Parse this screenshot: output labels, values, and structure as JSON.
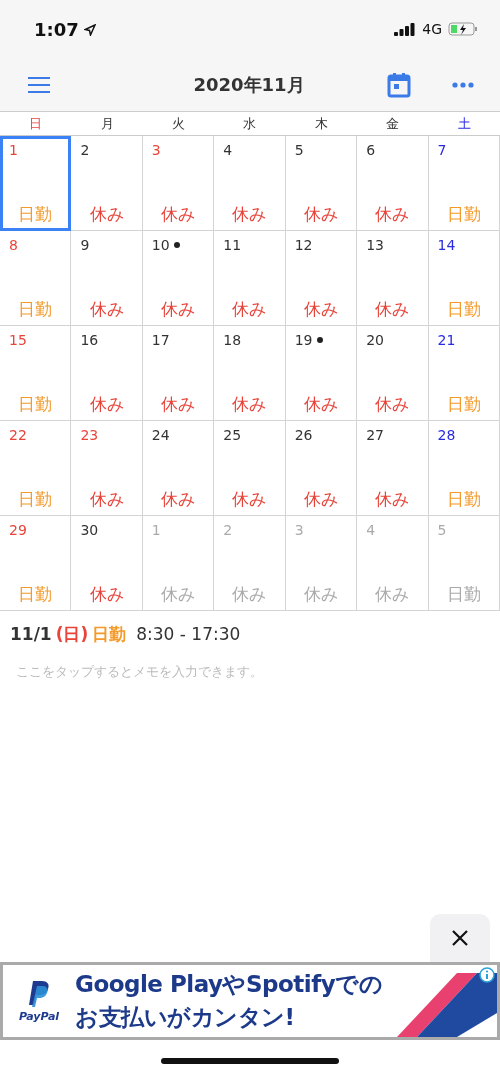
{
  "status_bar": {
    "time": "1:07",
    "network": "4G"
  },
  "header": {
    "title": "2020年11月"
  },
  "weekdays": [
    {
      "label": "日",
      "kind": "sunday"
    },
    {
      "label": "月",
      "kind": "weekday"
    },
    {
      "label": "火",
      "kind": "weekday"
    },
    {
      "label": "水",
      "kind": "weekday"
    },
    {
      "label": "木",
      "kind": "weekday"
    },
    {
      "label": "金",
      "kind": "weekday"
    },
    {
      "label": "土",
      "kind": "saturday"
    }
  ],
  "days": [
    {
      "number": "1",
      "kind": "sunday",
      "shift": {
        "label": "日勤",
        "kind": "work"
      },
      "dimmed": false,
      "dot": false,
      "selected": true
    },
    {
      "number": "2",
      "kind": "weekday",
      "shift": {
        "label": "休み",
        "kind": "off"
      },
      "dimmed": false,
      "dot": false,
      "selected": false
    },
    {
      "number": "3",
      "kind": "holiday",
      "shift": {
        "label": "休み",
        "kind": "off"
      },
      "dimmed": false,
      "dot": false,
      "selected": false
    },
    {
      "number": "4",
      "kind": "weekday",
      "shift": {
        "label": "休み",
        "kind": "off"
      },
      "dimmed": false,
      "dot": false,
      "selected": false
    },
    {
      "number": "5",
      "kind": "weekday",
      "shift": {
        "label": "休み",
        "kind": "off"
      },
      "dimmed": false,
      "dot": false,
      "selected": false
    },
    {
      "number": "6",
      "kind": "weekday",
      "shift": {
        "label": "休み",
        "kind": "off"
      },
      "dimmed": false,
      "dot": false,
      "selected": false
    },
    {
      "number": "7",
      "kind": "saturday",
      "shift": {
        "label": "日勤",
        "kind": "work"
      },
      "dimmed": false,
      "dot": false,
      "selected": false
    },
    {
      "number": "8",
      "kind": "sunday",
      "shift": {
        "label": "日勤",
        "kind": "work"
      },
      "dimmed": false,
      "dot": false,
      "selected": false
    },
    {
      "number": "9",
      "kind": "weekday",
      "shift": {
        "label": "休み",
        "kind": "off"
      },
      "dimmed": false,
      "dot": false,
      "selected": false
    },
    {
      "number": "10",
      "kind": "weekday",
      "shift": {
        "label": "休み",
        "kind": "off"
      },
      "dimmed": false,
      "dot": true,
      "selected": false
    },
    {
      "number": "11",
      "kind": "weekday",
      "shift": {
        "label": "休み",
        "kind": "off"
      },
      "dimmed": false,
      "dot": false,
      "selected": false
    },
    {
      "number": "12",
      "kind": "weekday",
      "shift": {
        "label": "休み",
        "kind": "off"
      },
      "dimmed": false,
      "dot": false,
      "selected": false
    },
    {
      "number": "13",
      "kind": "weekday",
      "shift": {
        "label": "休み",
        "kind": "off"
      },
      "dimmed": false,
      "dot": false,
      "selected": false
    },
    {
      "number": "14",
      "kind": "saturday",
      "shift": {
        "label": "日勤",
        "kind": "work"
      },
      "dimmed": false,
      "dot": false,
      "selected": false
    },
    {
      "number": "15",
      "kind": "sunday",
      "shift": {
        "label": "日勤",
        "kind": "work"
      },
      "dimmed": false,
      "dot": false,
      "selected": false
    },
    {
      "number": "16",
      "kind": "weekday",
      "shift": {
        "label": "休み",
        "kind": "off"
      },
      "dimmed": false,
      "dot": false,
      "selected": false
    },
    {
      "number": "17",
      "kind": "weekday",
      "shift": {
        "label": "休み",
        "kind": "off"
      },
      "dimmed": false,
      "dot": false,
      "selected": false
    },
    {
      "number": "18",
      "kind": "weekday",
      "shift": {
        "label": "休み",
        "kind": "off"
      },
      "dimmed": false,
      "dot": false,
      "selected": false
    },
    {
      "number": "19",
      "kind": "weekday",
      "shift": {
        "label": "休み",
        "kind": "off"
      },
      "dimmed": false,
      "dot": true,
      "selected": false
    },
    {
      "number": "20",
      "kind": "weekday",
      "shift": {
        "label": "休み",
        "kind": "off"
      },
      "dimmed": false,
      "dot": false,
      "selected": false
    },
    {
      "number": "21",
      "kind": "saturday",
      "shift": {
        "label": "日勤",
        "kind": "work"
      },
      "dimmed": false,
      "dot": false,
      "selected": false
    },
    {
      "number": "22",
      "kind": "sunday",
      "shift": {
        "label": "日勤",
        "kind": "work"
      },
      "dimmed": false,
      "dot": false,
      "selected": false
    },
    {
      "number": "23",
      "kind": "holiday",
      "shift": {
        "label": "休み",
        "kind": "off"
      },
      "dimmed": false,
      "dot": false,
      "selected": false
    },
    {
      "number": "24",
      "kind": "weekday",
      "shift": {
        "label": "休み",
        "kind": "off"
      },
      "dimmed": false,
      "dot": false,
      "selected": false
    },
    {
      "number": "25",
      "kind": "weekday",
      "shift": {
        "label": "休み",
        "kind": "off"
      },
      "dimmed": false,
      "dot": false,
      "selected": false
    },
    {
      "number": "26",
      "kind": "weekday",
      "shift": {
        "label": "休み",
        "kind": "off"
      },
      "dimmed": false,
      "dot": false,
      "selected": false
    },
    {
      "number": "27",
      "kind": "weekday",
      "shift": {
        "label": "休み",
        "kind": "off"
      },
      "dimmed": false,
      "dot": false,
      "selected": false
    },
    {
      "number": "28",
      "kind": "saturday",
      "shift": {
        "label": "日勤",
        "kind": "work"
      },
      "dimmed": false,
      "dot": false,
      "selected": false
    },
    {
      "number": "29",
      "kind": "sunday",
      "shift": {
        "label": "日勤",
        "kind": "work"
      },
      "dimmed": false,
      "dot": false,
      "selected": false
    },
    {
      "number": "30",
      "kind": "weekday",
      "shift": {
        "label": "休み",
        "kind": "off"
      },
      "dimmed": false,
      "dot": false,
      "selected": false
    },
    {
      "number": "1",
      "kind": "weekday",
      "shift": {
        "label": "休み",
        "kind": "off"
      },
      "dimmed": true,
      "dot": false,
      "selected": false
    },
    {
      "number": "2",
      "kind": "weekday",
      "shift": {
        "label": "休み",
        "kind": "off"
      },
      "dimmed": true,
      "dot": false,
      "selected": false
    },
    {
      "number": "3",
      "kind": "weekday",
      "shift": {
        "label": "休み",
        "kind": "off"
      },
      "dimmed": true,
      "dot": false,
      "selected": false
    },
    {
      "number": "4",
      "kind": "weekday",
      "shift": {
        "label": "休み",
        "kind": "off"
      },
      "dimmed": true,
      "dot": false,
      "selected": false
    },
    {
      "number": "5",
      "kind": "weekday",
      "shift": {
        "label": "日勤",
        "kind": "work"
      },
      "dimmed": true,
      "dot": false,
      "selected": false
    }
  ],
  "detail": {
    "date": "11/1",
    "weekday": {
      "label": "(日)",
      "kind": "sunday"
    },
    "shift": {
      "label": "日勤",
      "kind": "work"
    },
    "time": "8:30 - 17:30"
  },
  "memo": {
    "placeholder": "ここをタップするとメモを入力できます。"
  },
  "ad": {
    "brand": "PayPal",
    "headline": "Google PlayやSpotifyでの",
    "subline": "お支払いがカンタン!"
  }
}
